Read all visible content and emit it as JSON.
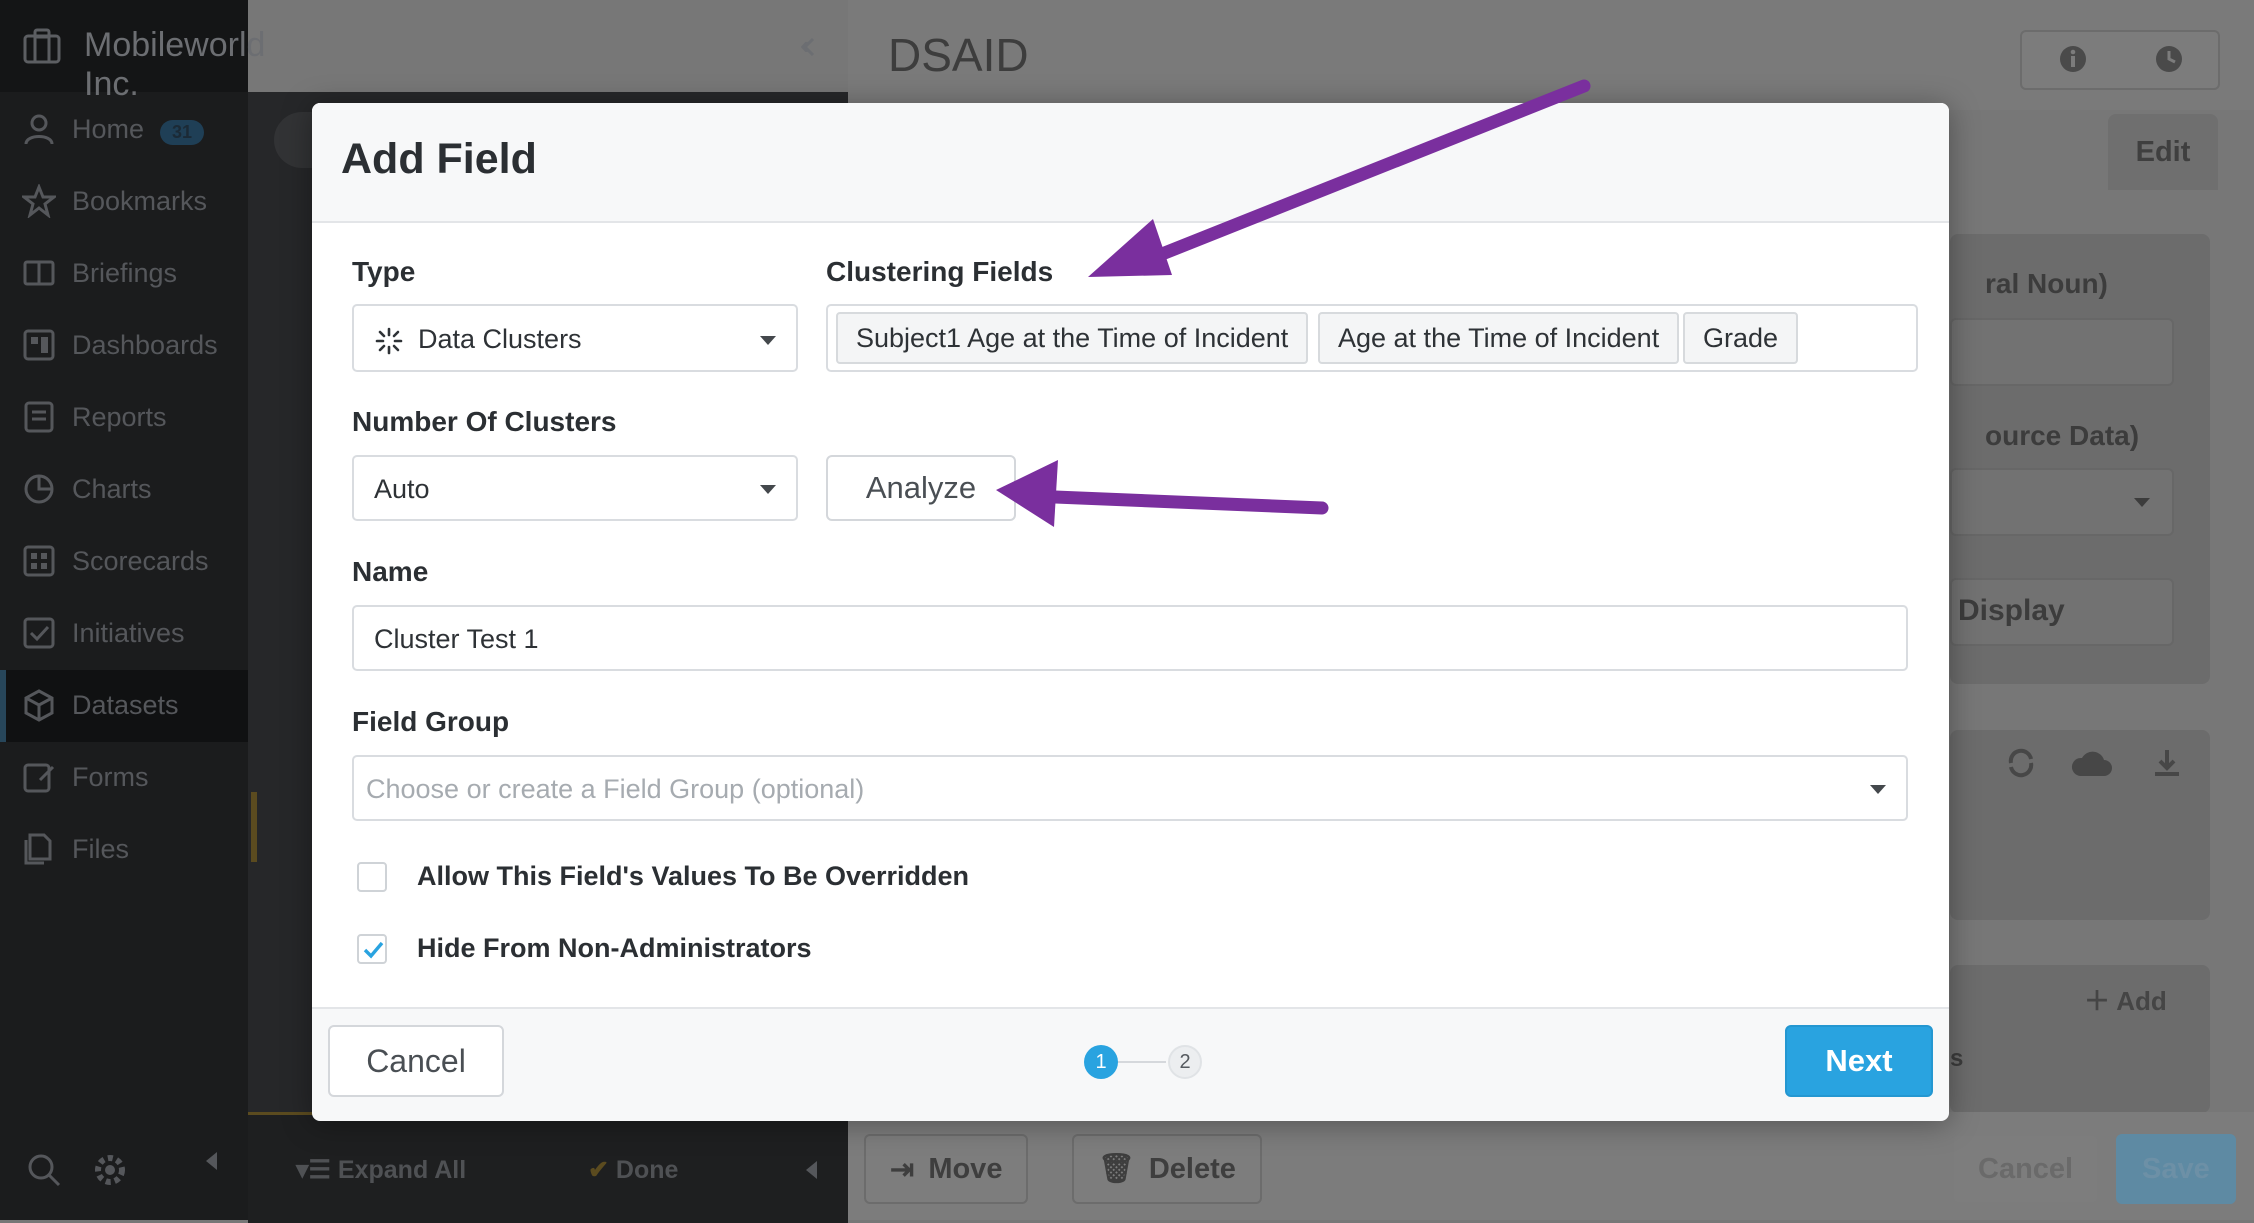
{
  "sidebar": {
    "org_name": "Mobileworld Inc.",
    "home_badge": "31",
    "items": [
      {
        "label": "Home",
        "icon": "user-icon"
      },
      {
        "label": "Bookmarks",
        "icon": "star-icon"
      },
      {
        "label": "Briefings",
        "icon": "book-icon"
      },
      {
        "label": "Dashboards",
        "icon": "dashboard-icon"
      },
      {
        "label": "Reports",
        "icon": "report-icon"
      },
      {
        "label": "Charts",
        "icon": "pie-chart-icon"
      },
      {
        "label": "Scorecards",
        "icon": "scorecard-icon"
      },
      {
        "label": "Initiatives",
        "icon": "checkbox-icon"
      },
      {
        "label": "Datasets",
        "icon": "cube-icon"
      },
      {
        "label": "Forms",
        "icon": "form-icon"
      },
      {
        "label": "Files",
        "icon": "files-icon"
      }
    ],
    "active_item": "Datasets"
  },
  "bottombar": {
    "expand_all": "Expand All",
    "done": "Done"
  },
  "main": {
    "title": "DSAID",
    "edit_tab": "Edit",
    "bg_label_1": "ral Noun)",
    "bg_label_2": "ource Data)",
    "bg_display": "Display",
    "bg_add": "Add",
    "bg_fragment": "s",
    "move": "Move",
    "delete": "Delete",
    "cancel": "Cancel",
    "save": "Save"
  },
  "modal": {
    "title": "Add Field",
    "type_label": "Type",
    "type_value": "Data Clusters",
    "clustering_label": "Clustering Fields",
    "clustering_tags": [
      "Subject1 Age at the Time of Incident",
      "Age at the Time of Incident",
      "Grade"
    ],
    "num_clusters_label": "Number Of Clusters",
    "num_clusters_value": "Auto",
    "analyze_label": "Analyze",
    "name_label": "Name",
    "name_value": "Cluster Test 1",
    "field_group_label": "Field Group",
    "field_group_placeholder": "Choose or create a Field Group (optional)",
    "allow_override_label": "Allow This Field's Values To Be Overridden",
    "allow_override_checked": false,
    "hide_label": "Hide From Non-Administrators",
    "hide_checked": true,
    "cancel_label": "Cancel",
    "next_label": "Next",
    "steps": [
      "1",
      "2"
    ],
    "current_step": 1,
    "accent_color": "#29a3e0",
    "arrow_color": "#7a2f9e"
  }
}
